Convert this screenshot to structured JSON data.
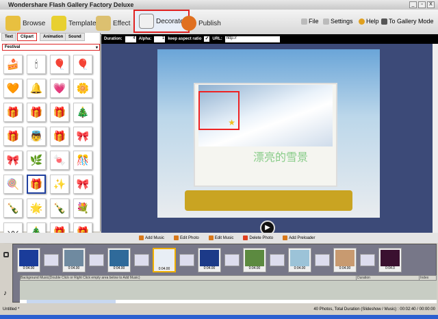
{
  "window": {
    "title": "Wondershare Flash Gallery Factory Deluxe",
    "min": "_",
    "max": "▫",
    "close": "X"
  },
  "toolbar": {
    "browse": "Browse",
    "template": "Template",
    "effect": "Effect",
    "decorate": "Decorate",
    "publish": "Publish"
  },
  "menu": {
    "file": "File",
    "settings": "Settings",
    "help": "Help",
    "gallery": "To Gallery Mode"
  },
  "left_tabs": [
    "Text",
    "Clipart",
    "Animation",
    "Sound"
  ],
  "category": "Festival",
  "clipart_icons": [
    "🍰",
    "🕯",
    "🎈",
    "🎈",
    "🧡",
    "🔔",
    "💗",
    "🌼",
    "🎁",
    "🎁",
    "🎁",
    "🎄",
    "🎁",
    "👼",
    "🎁",
    "🎀",
    "🎀",
    "🌿",
    "🍬",
    "🎊",
    "🍭",
    "🎁",
    "✨",
    "🎀",
    "🍾",
    "🌟",
    "🍾",
    "💐",
    "〰",
    "🎄",
    "🎁",
    "🎁"
  ],
  "options": {
    "duration_label": "Duration:",
    "duration": "4",
    "alpha_label": "Alpha:",
    "alpha": "1",
    "keep_label": "keep aspect ratio",
    "keep_checked": true,
    "url_label": "URL:",
    "url": "http://"
  },
  "preview": {
    "caption": "漂亮的雪景",
    "play": "▶"
  },
  "bottom_toolbar": {
    "add_music": "Add Music",
    "edit_photo": "Edit Photo",
    "edit_music": "Edit Music",
    "delete_photo": "Delete Photo",
    "add_preloader": "Add Preloader"
  },
  "thumbs": [
    {
      "d": "0:04.00",
      "c": "#1a3c9a"
    },
    {
      "d": "0:04.00",
      "c": "#6f8aa0"
    },
    {
      "d": "0:04.00",
      "c": "#2f6a9a"
    },
    {
      "d": "0:04.00",
      "c": "#e8eef5"
    },
    {
      "d": "0:04.00",
      "c": "#1c3a88"
    },
    {
      "d": "0:04.00",
      "c": "#5c8a40"
    },
    {
      "d": "0:04.00",
      "c": "#9cc3d8"
    },
    {
      "d": "0:04.00",
      "c": "#c89a70"
    },
    {
      "d": "0:04.0",
      "c": "#3a1030"
    }
  ],
  "music": {
    "header": "Background Music(Double Click or Right Click empty area below to Add Music)",
    "duration": "Duration",
    "index": "Index"
  },
  "status": {
    "file": "Untitled *",
    "summary": "40 Photos, Total Duration (Slideshow / Music) : 00:02:40 / 00:00:00"
  }
}
